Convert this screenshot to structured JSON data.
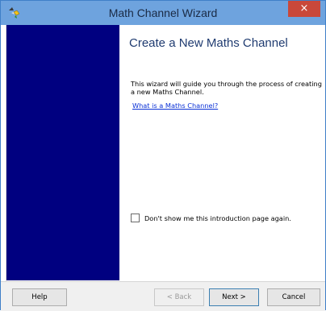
{
  "window": {
    "title": "Math Channel Wizard",
    "close_glyph": "×",
    "app_icon": "wizard-app-icon"
  },
  "page": {
    "heading": "Create a New Maths Channel",
    "intro_text": "This wizard will guide you through the process of creating a new Maths Channel.",
    "link_text": "What is a Maths Channel?",
    "checkbox_label": "Don't show me this introduction page again.",
    "checkbox_checked": false
  },
  "footer": {
    "help_label": "Help",
    "back_label": "< Back",
    "next_label": "Next >",
    "cancel_label": "Cancel"
  },
  "colors": {
    "side_panel": "#000080",
    "titlebar": "#6ea3de",
    "close_button": "#c9483a",
    "link": "#0a31d6"
  }
}
